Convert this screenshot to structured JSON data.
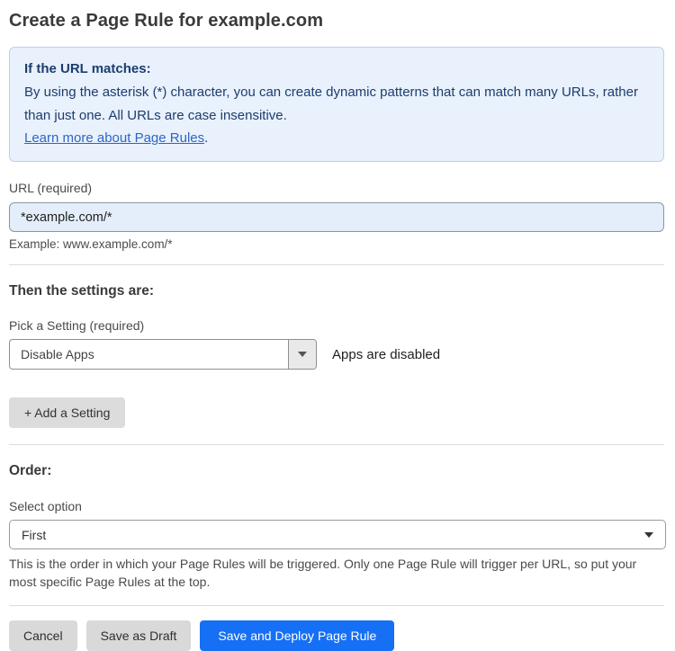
{
  "page": {
    "title": "Create a Page Rule for example.com"
  },
  "info_box": {
    "heading": "If the URL matches:",
    "body": "By using the asterisk (*) character, you can create dynamic patterns that can match many URLs, rather than just one. All URLs are case insensitive.",
    "link_label": "Learn more about Page Rules",
    "link_suffix": "."
  },
  "url_field": {
    "label": "URL (required)",
    "value": "*example.com/*",
    "helper": "Example: www.example.com/*"
  },
  "settings": {
    "heading": "Then the settings are:",
    "picker_label": "Pick a Setting (required)",
    "selected_value": "Disable Apps",
    "status_text": "Apps are disabled",
    "add_button_label": "+ Add a Setting"
  },
  "order": {
    "heading": "Order:",
    "select_label": "Select option",
    "selected_value": "First",
    "helper": "This is the order in which your Page Rules will be triggered. Only one Page Rule will trigger per URL, so put your most specific Page Rules at the top."
  },
  "actions": {
    "cancel_label": "Cancel",
    "save_draft_label": "Save as Draft",
    "save_deploy_label": "Save and Deploy Page Rule"
  },
  "colors": {
    "info_background": "#e8f1fc",
    "info_border": "#b9d3ef",
    "info_text": "#1d3d6e",
    "link_blue": "#2e65c8",
    "url_input_background": "#e4eefb",
    "primary_button_blue": "#1570f5",
    "secondary_button_gray": "#d9d9d9"
  },
  "icons": {
    "dropdown_arrow": "caret-down"
  }
}
